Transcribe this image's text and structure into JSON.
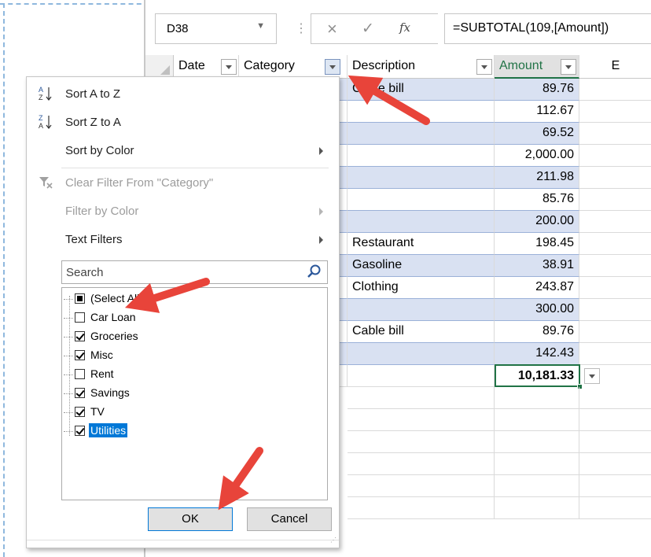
{
  "formula_bar": {
    "name_box": "D38",
    "formula": "=SUBTOTAL(109,[Amount])",
    "fx_label": "fx"
  },
  "columns": {
    "date": "Date",
    "category": "Category",
    "description": "Description",
    "amount": "Amount",
    "e": "E"
  },
  "rows": [
    {
      "description": "Cable bill",
      "amount": "89.76",
      "band": true
    },
    {
      "description": "",
      "amount": "112.67",
      "band": false
    },
    {
      "description": "",
      "amount": "69.52",
      "band": true
    },
    {
      "description": "",
      "amount": "2,000.00",
      "band": false
    },
    {
      "description": "",
      "amount": "211.98",
      "band": true
    },
    {
      "description": "",
      "amount": "85.76",
      "band": false
    },
    {
      "description": "",
      "amount": "200.00",
      "band": true
    },
    {
      "description": "Restaurant",
      "amount": "198.45",
      "band": false
    },
    {
      "description": "Gasoline",
      "amount": "38.91",
      "band": true
    },
    {
      "description": "Clothing",
      "amount": "243.87",
      "band": false
    },
    {
      "description": "",
      "amount": "300.00",
      "band": true
    },
    {
      "description": "Cable bill",
      "amount": "89.76",
      "band": false
    },
    {
      "description": "",
      "amount": "142.43",
      "band": true
    }
  ],
  "total": "10,181.33",
  "menu": {
    "sort_az": "Sort A to Z",
    "sort_za": "Sort Z to A",
    "sort_by_color": "Sort by Color",
    "clear_filter": "Clear Filter From \"Category\"",
    "filter_by_color": "Filter by Color",
    "text_filters": "Text Filters",
    "search_placeholder": "Search",
    "items": [
      {
        "label": "(Select All)",
        "state": "partial"
      },
      {
        "label": "Car Loan",
        "state": "unchecked"
      },
      {
        "label": "Groceries",
        "state": "checked"
      },
      {
        "label": "Misc",
        "state": "checked"
      },
      {
        "label": "Rent",
        "state": "unchecked"
      },
      {
        "label": "Savings",
        "state": "checked"
      },
      {
        "label": "TV",
        "state": "checked"
      },
      {
        "label": "Utilities",
        "state": "checked"
      }
    ],
    "ok": "OK",
    "cancel": "Cancel"
  },
  "colors": {
    "table_band": "#d9e1f2",
    "excel_green": "#217346",
    "selection_blue": "#0078d7",
    "arrow_red": "#e8443a"
  }
}
